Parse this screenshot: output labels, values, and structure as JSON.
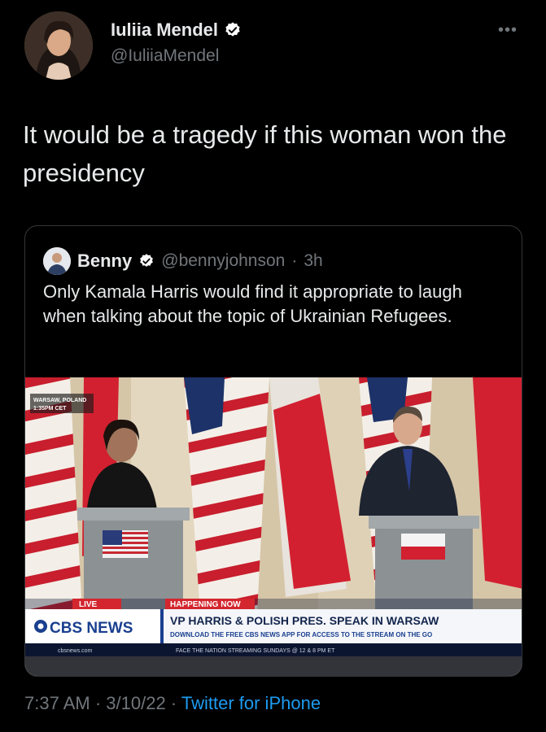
{
  "author": {
    "display_name": "Iuliia Mendel",
    "handle": "@IuliiaMendel",
    "verified": true,
    "avatar_icon": "profile-photo-icon"
  },
  "tweet": {
    "text": "It would be a tragedy if this woman won the presidency",
    "time": "7:37 AM",
    "date": "3/10/22",
    "source": "Twitter for iPhone",
    "separator": "·"
  },
  "quoted": {
    "display_name": "Benny",
    "handle": "@bennyjohnson",
    "age": "3h",
    "verified": true,
    "text": "Only Kamala Harris would find it appropriate to laugh when talking about the topic of Ukrainian Refugees."
  },
  "media_overlay": {
    "location": "WARSAW, POLAND",
    "time": "1:35PM CET",
    "live": "LIVE",
    "network": "CBS NEWS",
    "tag": "HAPPENING NOW",
    "headline": "VP HARRIS & POLISH PRES. SPEAK IN WARSAW",
    "subline": "DOWNLOAD THE FREE CBS NEWS APP FOR ACCESS TO THE STREAM ON THE GO",
    "website": "cbsnews.com",
    "ticker": "FACE THE NATION STREAMING SUNDAYS @ 12 & 8 PM ET"
  },
  "colors": {
    "background": "#000000",
    "text": "#e7e9ea",
    "muted": "#71767b",
    "link": "#1d9bf0",
    "verified": "#1d9bf0",
    "cbs_blue": "#1a3f8f",
    "polish_red": "#d22030"
  }
}
